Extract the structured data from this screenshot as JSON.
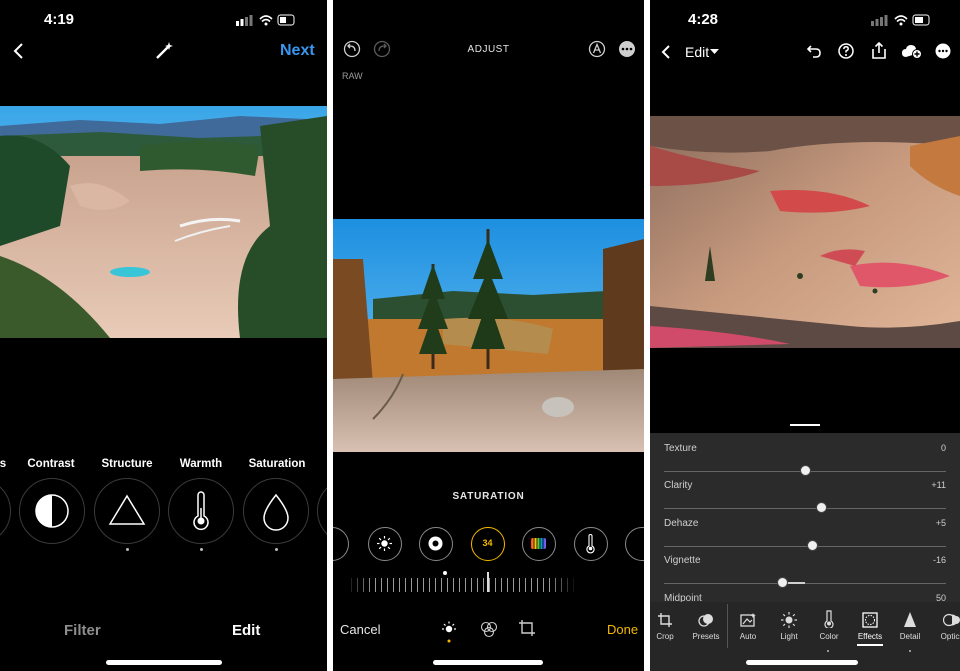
{
  "panel1": {
    "status_time": "4:19",
    "next_label": "Next",
    "tools": [
      {
        "label": "s"
      },
      {
        "label": "Contrast"
      },
      {
        "label": "Structure"
      },
      {
        "label": "Warmth"
      },
      {
        "label": "Saturation"
      }
    ],
    "tabs": {
      "filter": "Filter",
      "edit": "Edit"
    },
    "accent": "#3897f0"
  },
  "panel2": {
    "title": "ADJUST",
    "raw_label": "RAW",
    "mode_label": "SATURATION",
    "active_value": "34",
    "cancel_label": "Cancel",
    "done_label": "Done",
    "accent": "#f5b800"
  },
  "panel3": {
    "status_time": "4:28",
    "edit_menu": "Edit",
    "sliders": [
      {
        "label": "Texture",
        "value": "0",
        "level": 0
      },
      {
        "label": "Clarity",
        "value": "+11",
        "level": 11
      },
      {
        "label": "Dehaze",
        "value": "+5",
        "level": 5
      },
      {
        "label": "Vignette",
        "value": "-16",
        "level": -16
      },
      {
        "label": "Midpoint",
        "value": "50",
        "level": 50
      }
    ],
    "tools": [
      {
        "label": "Crop",
        "icon": "crop-icon"
      },
      {
        "label": "Presets",
        "icon": "presets-icon"
      },
      {
        "label": "Auto",
        "icon": "auto-icon"
      },
      {
        "label": "Light",
        "icon": "light-icon"
      },
      {
        "label": "Color",
        "icon": "color-icon"
      },
      {
        "label": "Effects",
        "icon": "effects-icon"
      },
      {
        "label": "Detail",
        "icon": "detail-icon"
      },
      {
        "label": "Optics",
        "icon": "optics-icon"
      }
    ]
  }
}
